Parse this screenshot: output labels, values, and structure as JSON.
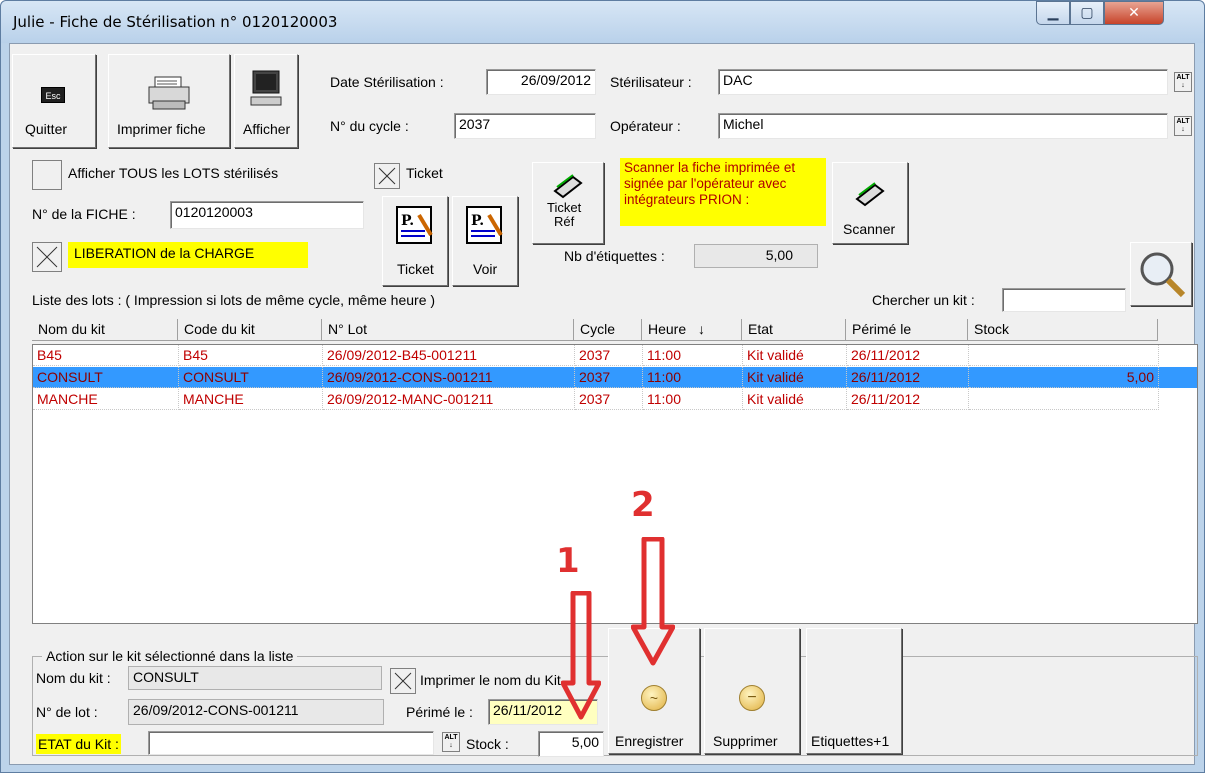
{
  "window": {
    "title": "Julie - Fiche de Stérilisation n° 0120120003"
  },
  "toolbar": {
    "esc_icon_text": "Esc",
    "quitter_label": "Quitter",
    "imprimer_label": "Imprimer fiche",
    "afficher_label": "Afficher"
  },
  "header": {
    "date_label": "Date Stérilisation :",
    "date_value": "26/09/2012",
    "cycle_label": "N° du cycle :",
    "cycle_value": "2037",
    "sterilisateur_label": "Stérilisateur :",
    "sterilisateur_value": "DAC",
    "operateur_label": "Opérateur :",
    "operateur_value": "Michel",
    "alt_text": "ALT"
  },
  "options": {
    "afficher_tous_label": "Afficher TOUS les LOTS stérilisés",
    "ticket_checkbox_label": "Ticket",
    "fiche_label": "N° de la FICHE :",
    "fiche_value": "0120120003",
    "liberation_label": "LIBERATION de la CHARGE",
    "ticket_button_label": "Ticket",
    "voir_button_label": "Voir",
    "ticket_ref_label": "Ticket\nRéf",
    "scan_note": "Scanner la fiche imprimée et signée par l'opérateur avec intégrateurs PRION :",
    "scanner_label": "Scanner",
    "nb_etiquettes_label": "Nb d'étiquettes :",
    "nb_etiquettes_value": "5,00",
    "liste_label": "Liste des lots : ( Impression si lots de même cycle, même heure )",
    "chercher_label": "Chercher un kit :",
    "chercher_value": ""
  },
  "table": {
    "columns": [
      "Nom du kit",
      "Code du kit",
      "N° Lot",
      "Cycle",
      "Heure",
      "Etat",
      "Périmé le",
      "Stock"
    ],
    "sort_indicator": "↓",
    "rows": [
      {
        "nom": "B45",
        "code": "B45",
        "lot": "26/09/2012-B45-001211",
        "cycle": "2037",
        "heure": "11:00",
        "etat": "Kit validé",
        "perime": "26/11/2012",
        "stock": "",
        "selected": false
      },
      {
        "nom": "CONSULT",
        "code": "CONSULT",
        "lot": "26/09/2012-CONS-001211",
        "cycle": "2037",
        "heure": "11:00",
        "etat": "Kit validé",
        "perime": "26/11/2012",
        "stock": "5,00",
        "selected": true
      },
      {
        "nom": "MANCHE",
        "code": "MANCHE",
        "lot": "26/09/2012-MANC-001211",
        "cycle": "2037",
        "heure": "11:00",
        "etat": "Kit validé",
        "perime": "26/11/2012",
        "stock": "",
        "selected": false
      }
    ]
  },
  "action": {
    "legend": "Action sur le kit sélectionné dans la liste",
    "nom_kit_label": "Nom du kit :",
    "nom_kit_value": "CONSULT",
    "imprimer_nom_label": "Imprimer le nom du Kit",
    "lot_label": "N° de lot :",
    "lot_value": "26/09/2012-CONS-001211",
    "perime_label": "Périmé le :",
    "perime_value": "26/11/2012",
    "etat_label": "ETAT du Kit :",
    "etat_value": "",
    "stock_label": "Stock :",
    "stock_value": "5,00",
    "enregistrer_label": "Enregistrer",
    "supprimer_label": "Supprimer",
    "etiquettes_label": "Etiquettes+1"
  },
  "annotations": {
    "arrow1_label": "1",
    "arrow2_label": "2",
    "arrow_color": "#e03030"
  },
  "colors": {
    "selection": "#3399ff",
    "row_text": "#c00000",
    "highlight_yellow": "#ffff00",
    "date_highlight": "#ffffc0"
  }
}
